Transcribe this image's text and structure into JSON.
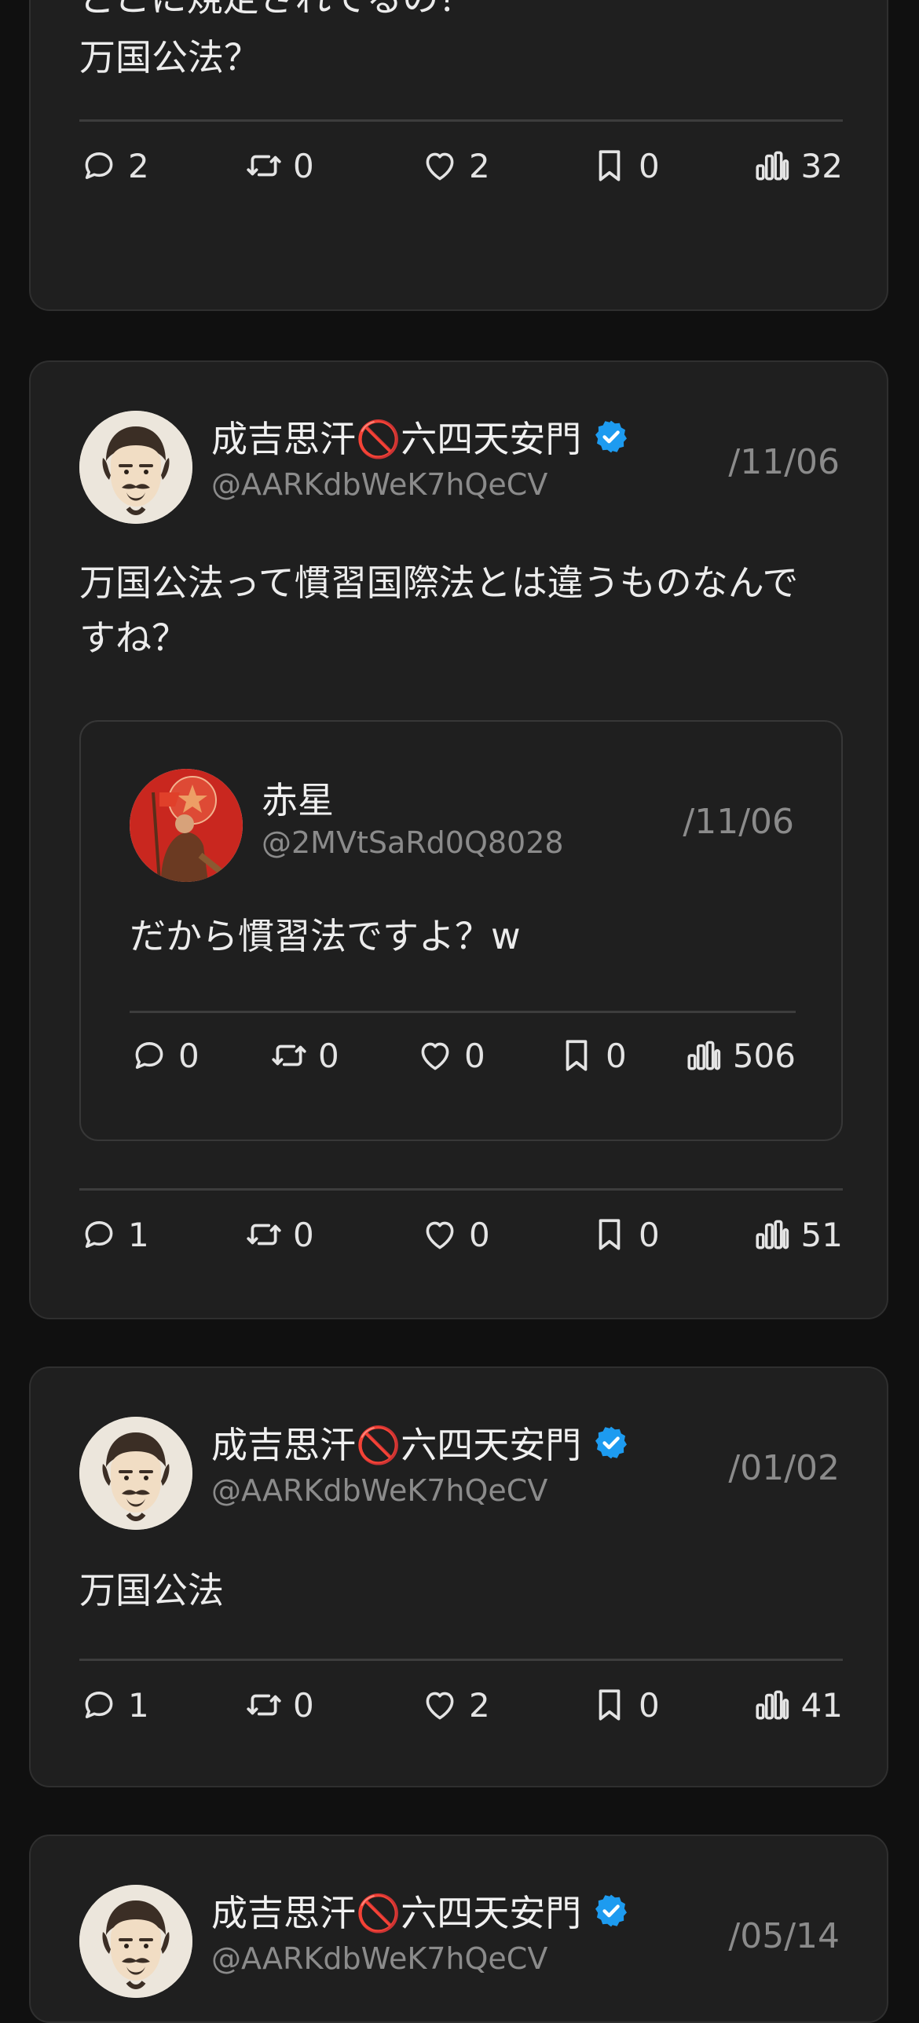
{
  "posts": [
    {
      "partial_text": "どこに規定されてるの？",
      "text": "万国公法？",
      "stats": {
        "replies": "2",
        "reposts": "0",
        "likes": "2",
        "bookmarks": "0",
        "views": "32"
      }
    },
    {
      "name": "成吉思汗🚫六四天安門",
      "handle": "@AARKdbWeK7hQeCV",
      "date": "/11/06",
      "text_line1": "万国公法って慣習国際法とは違うものなんで",
      "text_line2": "すね？",
      "quote": {
        "name": "赤星",
        "handle": "@2MVtSaRd0Q8028",
        "date": "/11/06",
        "text": "だから慣習法ですよ？w",
        "stats": {
          "replies": "0",
          "reposts": "0",
          "likes": "0",
          "bookmarks": "0",
          "views": "506"
        }
      },
      "stats": {
        "replies": "1",
        "reposts": "0",
        "likes": "0",
        "bookmarks": "0",
        "views": "51"
      }
    },
    {
      "name": "成吉思汗🚫六四天安門",
      "handle": "@AARKdbWeK7hQeCV",
      "date": "/01/02",
      "text": "万国公法",
      "stats": {
        "replies": "1",
        "reposts": "0",
        "likes": "2",
        "bookmarks": "0",
        "views": "41"
      }
    },
    {
      "name": "成吉思汗🚫六四天安門",
      "handle": "@AARKdbWeK7hQeCV",
      "date": "/05/14"
    }
  ],
  "colors": {
    "verified": "#1d9bf0",
    "card": "#1f1f1f",
    "background": "#101010"
  }
}
